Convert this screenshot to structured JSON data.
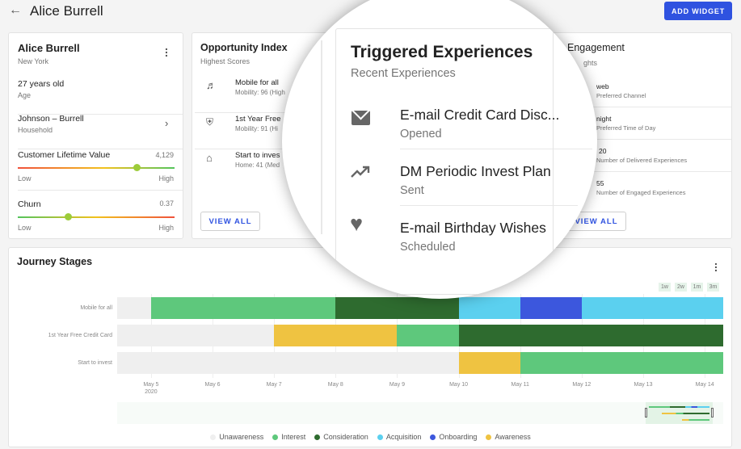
{
  "header": {
    "title": "Alice Burrell",
    "add_widget": "ADD WIDGET"
  },
  "profile": {
    "name": "Alice Burrell",
    "city": "New York",
    "age_value": "27 years old",
    "age_label": "Age",
    "household_value": "Johnson – Burrell",
    "household_label": "Household",
    "clv": {
      "label": "Customer Lifetime Value",
      "value": "4,129",
      "low": "Low",
      "high": "High",
      "level": 0.76
    },
    "churn": {
      "label": "Churn",
      "value": "0.37",
      "low": "Low",
      "high": "High",
      "level": 0.32
    }
  },
  "opportunity": {
    "title": "Opportunity Index",
    "subtitle": "Highest Scores",
    "view_all": "VIEW ALL",
    "items": [
      {
        "icon": "pool-icon",
        "title": "Mobile for all",
        "sub": "Mobility: 96 (High"
      },
      {
        "icon": "car-icon",
        "title": "1st Year Free",
        "sub": "Mobility: 91 (Hi"
      },
      {
        "icon": "home-icon",
        "title": "Start to inves",
        "sub": "Home: 41 (Med"
      }
    ]
  },
  "triggered": {
    "title": "Triggered Experiences",
    "subtitle": "Recent Experiences",
    "items": [
      {
        "icon": "email-icon",
        "title": "E-mail Credit Card Disc...",
        "status": "Opened"
      },
      {
        "icon": "trending-up-icon",
        "title": "DM Periodic Invest Plan",
        "status": "Sent"
      },
      {
        "icon": "heart-icon",
        "title": "E-mail Birthday Wishes",
        "status": "Scheduled"
      }
    ]
  },
  "engagement": {
    "title": "Engagement",
    "subtitle": "ghts",
    "view_all": "VIEW ALL",
    "items": [
      {
        "value": "web",
        "label": "Preferred Channel"
      },
      {
        "value": "night",
        "label": "Preferred Time of Day"
      },
      {
        "value": "20",
        "label": "Number of Delivered Experiences"
      },
      {
        "value": "55",
        "label": "Number of Engaged Experiences"
      }
    ]
  },
  "journey": {
    "title": "Journey Stages",
    "ranges": [
      "1w",
      "2w",
      "1m",
      "3m"
    ]
  },
  "chart_data": {
    "type": "timeline",
    "x_range": [
      "May 4 2020 11:00",
      "May 14 2020 07:00"
    ],
    "ticks": [
      "May 5",
      "May 6",
      "May 7",
      "May 8",
      "May 9",
      "May 10",
      "May 11",
      "May 12",
      "May 13",
      "May 14"
    ],
    "year_label": "2020",
    "stage_colors": {
      "Unawareness": "#efefef",
      "Interest": "#5ec87c",
      "Consideration": "#2e6b2f",
      "Acquisition": "#5bd0ef",
      "Onboarding": "#3c57dd",
      "Awareness": "#efc341"
    },
    "legend": [
      "Unawareness",
      "Interest",
      "Consideration",
      "Acquisition",
      "Onboarding",
      "Awareness"
    ],
    "rows": [
      {
        "name": "Mobile for all",
        "segments": [
          [
            "Unawareness",
            4.45,
            5
          ],
          [
            "Interest",
            5,
            8
          ],
          [
            "Consideration",
            8,
            10
          ],
          [
            "Acquisition",
            10,
            11
          ],
          [
            "Onboarding",
            11,
            12
          ],
          [
            "Acquisition",
            12,
            14.3
          ]
        ]
      },
      {
        "name": "1st Year Free Credit Card",
        "segments": [
          [
            "Unawareness",
            4.45,
            7
          ],
          [
            "Awareness",
            7,
            9
          ],
          [
            "Interest",
            9,
            10
          ],
          [
            "Consideration",
            10,
            14.3
          ]
        ]
      },
      {
        "name": "Start to invest",
        "segments": [
          [
            "Unawareness",
            4.45,
            10
          ],
          [
            "Awareness",
            10,
            11
          ],
          [
            "Interest",
            11,
            14.3
          ]
        ]
      }
    ]
  }
}
